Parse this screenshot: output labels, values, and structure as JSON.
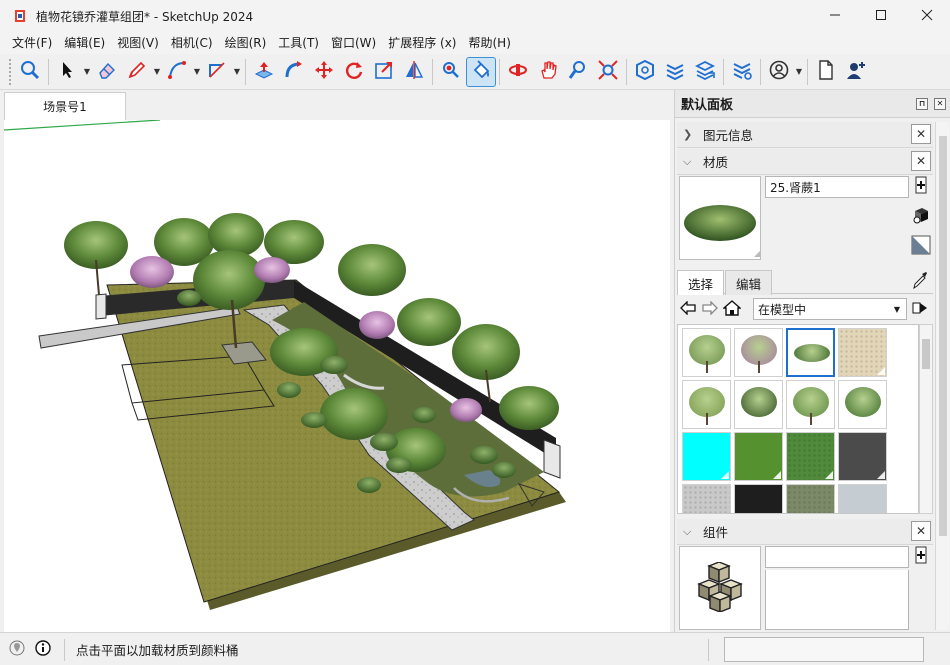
{
  "window": {
    "title": "植物花镜乔灌草组团* - SketchUp 2024",
    "controls": [
      "minimize-icon",
      "maximize-icon",
      "close-icon"
    ]
  },
  "menu": [
    "文件(F)",
    "编辑(E)",
    "视图(V)",
    "相机(C)",
    "绘图(R)",
    "工具(T)",
    "窗口(W)",
    "扩展程序 (x)",
    "帮助(H)"
  ],
  "toolbar": {
    "tools": [
      "zoom-icon",
      "select-icon",
      "eraser-icon",
      "pencil-icon",
      "arc-icon",
      "rectangle-icon",
      "push-pull-icon",
      "follow-me-icon",
      "move-icon",
      "rotate-icon",
      "scale-icon",
      "section-icon",
      "walk-icon",
      "paint-bucket-icon",
      "orbit-icon",
      "pan-icon",
      "zoom-window-icon",
      "zoom-extents-icon",
      "warehouse-icon",
      "extension-icon",
      "layer-icon",
      "solid-tools-icon",
      "account-icon",
      "new-file-icon",
      "add-user-icon"
    ],
    "active_tool": "paint-bucket-icon"
  },
  "scene": {
    "tab_label": "场景号1"
  },
  "tray": {
    "title": "默认面板",
    "entity_info": "图元信息",
    "materials": {
      "title": "材质",
      "current_name": "25.肾蕨1",
      "tabs": [
        "选择",
        "编辑"
      ],
      "active_tab": "选择",
      "library": "在模型中",
      "swatches": [
        {
          "name": "tree-white",
          "color": "#6b8f4a"
        },
        {
          "name": "tree-pink",
          "color": "#a57aa0"
        },
        {
          "name": "fern",
          "color": "#3f6b2f",
          "selected": true
        },
        {
          "name": "sand",
          "color": "#e3d6b8"
        },
        {
          "name": "tree-tall",
          "color": "#7a9a4c"
        },
        {
          "name": "shrub-dark",
          "color": "#2e4f1f"
        },
        {
          "name": "tree-small",
          "color": "#5d8a3e"
        },
        {
          "name": "shrub-round",
          "color": "#3d6e2a"
        },
        {
          "name": "cyan",
          "color": "#00ffff"
        },
        {
          "name": "green",
          "color": "#55912f"
        },
        {
          "name": "grass",
          "color": "#4f8b3a"
        },
        {
          "name": "dark-grey",
          "color": "#4b4b4b"
        },
        {
          "name": "gravel",
          "color": "#c9c9c9"
        },
        {
          "name": "black",
          "color": "#1e1e1e"
        },
        {
          "name": "pebbles",
          "color": "#7d8a6a"
        },
        {
          "name": "light-blue-grey",
          "color": "#c5ccd2"
        }
      ]
    },
    "components": {
      "title": "组件"
    }
  },
  "status": {
    "hint": "点击平面以加载材质到颜料桶"
  },
  "colors": {
    "accent": "#1f6fd1",
    "lawn": "#8a8a3e",
    "path": "#c7c7c7"
  }
}
